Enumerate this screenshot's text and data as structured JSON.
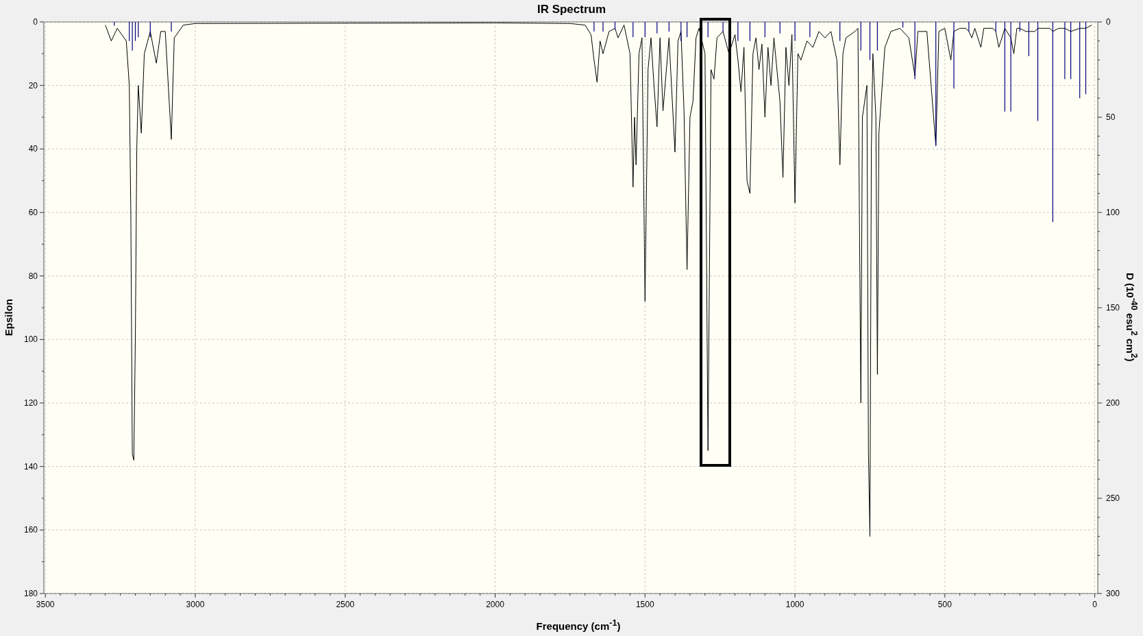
{
  "title": "IR Spectrum",
  "spectrum": {
    "chart_data": {
      "type": "line",
      "xlabel": "Frequency (cm$^{-1}$)",
      "ylabel": "Epsilon",
      "xlim": [
        3505,
        -10
      ],
      "ylim": [
        180,
        0
      ],
      "xticks": [
        3500,
        3000,
        2500,
        2000,
        1500,
        1000,
        500,
        0
      ],
      "yticks": [
        0,
        20,
        40,
        60,
        80,
        100,
        120,
        140,
        160,
        180
      ],
      "x": [
        3300,
        3280,
        3270,
        3260,
        3230,
        3220,
        3215,
        3210,
        3205,
        3200,
        3195,
        3190,
        3180,
        3170,
        3150,
        3130,
        3115,
        3100,
        3080,
        3070,
        3040,
        3000,
        2000,
        1750,
        1700,
        1680,
        1670,
        1660,
        1650,
        1640,
        1620,
        1600,
        1590,
        1570,
        1550,
        1540,
        1535,
        1530,
        1520,
        1510,
        1500,
        1490,
        1480,
        1470,
        1460,
        1450,
        1440,
        1420,
        1400,
        1390,
        1380,
        1370,
        1360,
        1350,
        1340,
        1330,
        1320,
        1300,
        1290,
        1280,
        1270,
        1260,
        1240,
        1220,
        1200,
        1190,
        1180,
        1170,
        1160,
        1150,
        1140,
        1130,
        1120,
        1110,
        1100,
        1090,
        1080,
        1070,
        1050,
        1040,
        1030,
        1020,
        1010,
        1000,
        990,
        980,
        960,
        950,
        940,
        920,
        900,
        880,
        860,
        850,
        840,
        830,
        800,
        790,
        780,
        775,
        760,
        755,
        750,
        745,
        740,
        730,
        725,
        720,
        700,
        680,
        650,
        640,
        620,
        600,
        590,
        560,
        530,
        520,
        500,
        480,
        470,
        450,
        430,
        420,
        410,
        400,
        380,
        370,
        340,
        330,
        320,
        300,
        280,
        270,
        260,
        250,
        230,
        220,
        200,
        190,
        180,
        150,
        140,
        120,
        100,
        80,
        50,
        40,
        30,
        10
      ],
      "series": [
        {
          "color": "#000000",
          "values": [
            1,
            6,
            4,
            2,
            6,
            20,
            60,
            136,
            138,
            100,
            40,
            20,
            35,
            10,
            3,
            13,
            3,
            3,
            37,
            5,
            1,
            0.5,
            0.3,
            0.5,
            1,
            4,
            12,
            19,
            6,
            10,
            3,
            2,
            5,
            1,
            10,
            52,
            30,
            45,
            10,
            5,
            88,
            15,
            5,
            20,
            33,
            5,
            28,
            5,
            41,
            6,
            3,
            28,
            78,
            30,
            25,
            5,
            2,
            10,
            135,
            15,
            18,
            5,
            3,
            10,
            4,
            12,
            22,
            8,
            50,
            54,
            10,
            5,
            15,
            7,
            30,
            8,
            20,
            5,
            25,
            49,
            8,
            20,
            4,
            57,
            10,
            12,
            6,
            7,
            8,
            3,
            5,
            3,
            12,
            45,
            10,
            5,
            3,
            2,
            120,
            30,
            20,
            135,
            162,
            40,
            10,
            30,
            111,
            35,
            8,
            3,
            2,
            3,
            5,
            17,
            3,
            3,
            39,
            3,
            2,
            12,
            3,
            2,
            2,
            3,
            5,
            2,
            8,
            2,
            2,
            3,
            8,
            2,
            5,
            10,
            2,
            2,
            3,
            3,
            3,
            2,
            2,
            2,
            3,
            2,
            2,
            3,
            2,
            2,
            2,
            1
          ]
        }
      ],
      "grid": true
    }
  },
  "right_axis": {
    "label": "D (10$^{-40}$ esu$^{2}$ cm$^{2}$)",
    "ticks": [
      "0",
      "50",
      "100",
      "150",
      "200",
      "250",
      "300"
    ]
  }
}
